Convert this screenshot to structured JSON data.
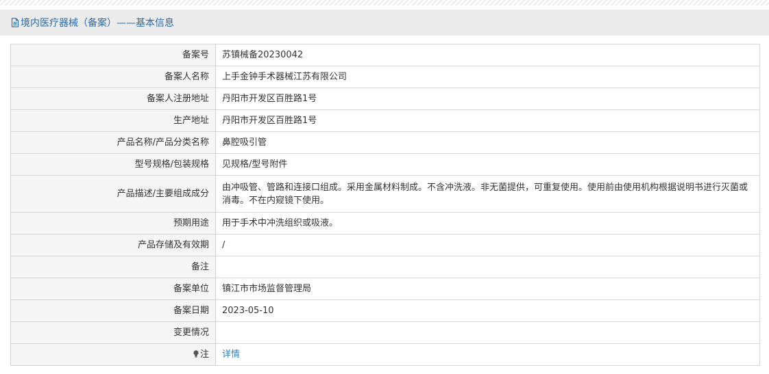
{
  "header": {
    "title": "境内医疗器械（备案）——基本信息",
    "icon": "document-icon",
    "color": "#2a6aa9"
  },
  "rows": [
    {
      "label": "备案号",
      "value": "苏镇械备20230042"
    },
    {
      "label": "备案人名称",
      "value": "上手金钟手术器械江苏有限公司"
    },
    {
      "label": "备案人注册地址",
      "value": "丹阳市开发区百胜路1号"
    },
    {
      "label": "生产地址",
      "value": "丹阳市开发区百胜路1号"
    },
    {
      "label": "产品名称/产品分类名称",
      "value": "鼻腔吸引管"
    },
    {
      "label": "型号规格/包装规格",
      "value": "见规格/型号附件"
    },
    {
      "label": "产品描述/主要组成成分",
      "value": "由冲吸管、管路和连接口组成。采用金属材料制成。不含冲洗液。非无菌提供，可重复使用。使用前由使用机构根据说明书进行灭菌或消毒。不在内窥镜下使用。"
    },
    {
      "label": "预期用途",
      "value": "用于手术中冲洗组织或吸液。"
    },
    {
      "label": "产品存储及有效期",
      "value": "/"
    },
    {
      "label": "备注",
      "value": ""
    },
    {
      "label": "备案单位",
      "value": "镇江市市场监督管理局"
    },
    {
      "label": "备案日期",
      "value": "2023-05-10"
    },
    {
      "label": "变更情况",
      "value": ""
    }
  ],
  "note": {
    "label": "注",
    "icon": "lightbulb-icon",
    "link_label": "详情",
    "link_color": "#2a83c9"
  }
}
